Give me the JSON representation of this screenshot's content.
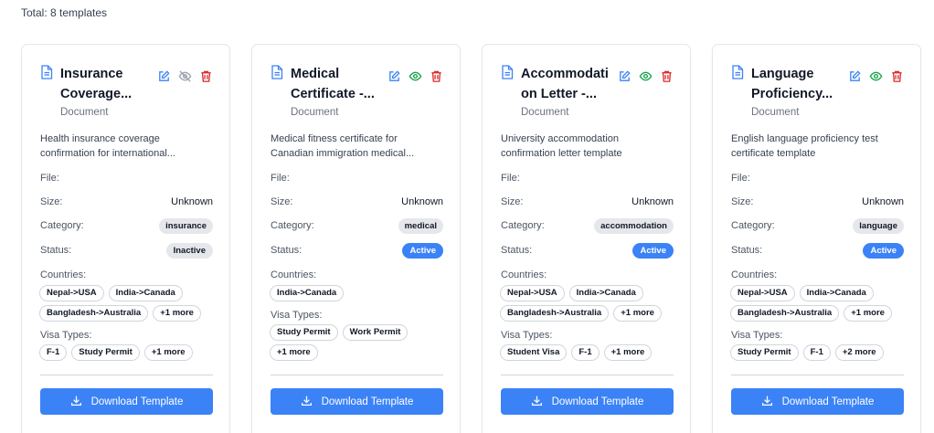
{
  "total_label": "Total: 8 templates",
  "colors": {
    "accent": "#3b82f6",
    "edit": "#3b82f6",
    "visible": "#16a34a",
    "hidden": "#9ca3af",
    "delete": "#dc2626"
  },
  "labels": {
    "file": "File:",
    "size": "Size:",
    "category": "Category:",
    "status": "Status:",
    "countries": "Countries:",
    "visa_types": "Visa Types:",
    "download": "Download Template"
  },
  "cards": [
    {
      "title_line1": "Insurance",
      "title_line2": "Coverage...",
      "subtype": "Document",
      "desc_line1": "Health insurance coverage",
      "desc_line2": "confirmation for international...",
      "file": "",
      "size": "Unknown",
      "category": "insurance",
      "status": "Inactive",
      "visibility_icon": "eye-off-icon",
      "countries": [
        "Nepal->USA",
        "India->Canada",
        "Bangladesh->Australia",
        "+1 more"
      ],
      "visa_types": [
        "F-1",
        "Study Permit",
        "+1 more"
      ]
    },
    {
      "title_line1": "Medical",
      "title_line2": "Certificate -...",
      "subtype": "Document",
      "desc_line1": "Medical fitness certificate for",
      "desc_line2": "Canadian immigration medical...",
      "file": "",
      "size": "Unknown",
      "category": "medical",
      "status": "Active",
      "visibility_icon": "eye-icon",
      "countries": [
        "India->Canada"
      ],
      "visa_types": [
        "Study Permit",
        "Work Permit",
        "+1 more"
      ]
    },
    {
      "title_line1": "Accommodati",
      "title_line2": "on Letter -...",
      "subtype": "Document",
      "desc_line1": "University accommodation",
      "desc_line2": "confirmation letter template",
      "file": "",
      "size": "Unknown",
      "category": "accommodation",
      "status": "Active",
      "visibility_icon": "eye-icon",
      "countries": [
        "Nepal->USA",
        "India->Canada",
        "Bangladesh->Australia",
        "+1 more"
      ],
      "visa_types": [
        "Student Visa",
        "F-1",
        "+1 more"
      ]
    },
    {
      "title_line1": "Language",
      "title_line2": "Proficiency...",
      "subtype": "Document",
      "desc_line1": "English language proficiency test",
      "desc_line2": "certificate template",
      "file": "",
      "size": "Unknown",
      "category": "language",
      "status": "Active",
      "visibility_icon": "eye-icon",
      "countries": [
        "Nepal->USA",
        "India->Canada",
        "Bangladesh->Australia",
        "+1 more"
      ],
      "visa_types": [
        "Study Permit",
        "F-1",
        "+2 more"
      ]
    }
  ]
}
